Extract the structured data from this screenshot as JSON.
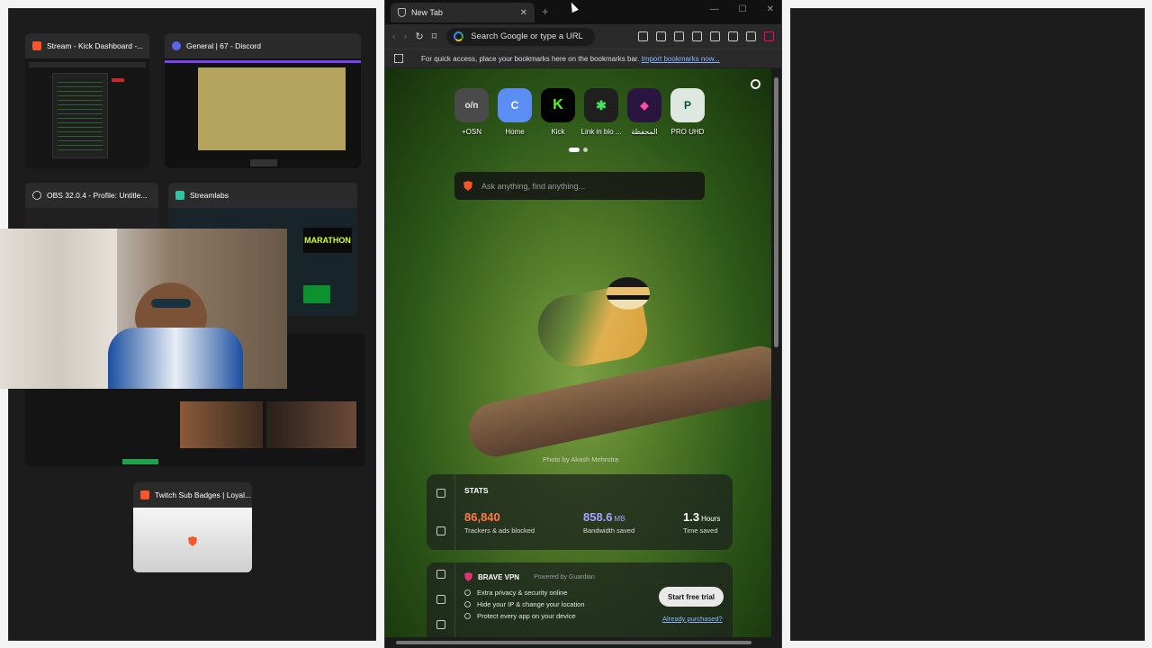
{
  "switcher": {
    "windows": [
      {
        "title": "Stream - Kick Dashboard -...",
        "icon": "brave-icon",
        "color": "#fb542b"
      },
      {
        "title": "General | 67 - Discord",
        "icon": "discord-icon",
        "color": "#5865f2"
      },
      {
        "title": "OBS 32.0.4 - Profile: Untitle...",
        "icon": "obs-icon",
        "color": "#666666"
      },
      {
        "title": "Streamlabs",
        "icon": "streamlabs-icon",
        "color": "#31c3a2"
      },
      {
        "title": "Twitch Sub Badges | Loyal...",
        "icon": "brave-icon",
        "color": "#fb542b"
      }
    ],
    "marathon_text": "MARATHON"
  },
  "browser": {
    "tab_title": "New Tab",
    "url_placeholder": "Search Google or type a URL",
    "bookmarks_text": "For quick access, place your bookmarks here on the bookmarks bar.",
    "bookmarks_link": "Import bookmarks now...",
    "tiles": [
      {
        "label": "+OSN",
        "glyph": "o/n",
        "color": "#e9e9e9",
        "bg": "#4a4a4a"
      },
      {
        "label": "Home",
        "glyph": "C",
        "color": "#ffffff",
        "bg": "#5b8df5"
      },
      {
        "label": "Kick",
        "glyph": "K",
        "color": "#000000",
        "bg": "#53fc18"
      },
      {
        "label": "Link in bio ...",
        "glyph": "✱",
        "color": "#000000",
        "bg": "#43e660"
      },
      {
        "label": "المحفظة",
        "glyph": "◆",
        "color": "#ff4da6",
        "bg": "#2a1540"
      },
      {
        "label": "PRO UHD",
        "glyph": "P",
        "color": "#0a4d3a",
        "bg": "#dfe8e0"
      }
    ],
    "search_placeholder": "Ask anything, find anything...",
    "photo_credit": "Photo by Akash Mehrotra",
    "stats": {
      "title": "STATS",
      "trackers": "86,840",
      "trackers_label": "Trackers & ads blocked",
      "bandwidth": "858.6",
      "bandwidth_unit": "MB",
      "bandwidth_label": "Bandwidth saved",
      "time": "1.3",
      "time_unit": "Hours",
      "time_label": "Time saved"
    },
    "vpn": {
      "title": "BRAVE VPN",
      "powered": "Powered by Guardian",
      "items": [
        "Extra privacy & security online",
        "Hide your IP & change your location",
        "Protect every app on your device"
      ],
      "trial_button": "Start free trial",
      "already_link": "Already purchased?"
    }
  }
}
